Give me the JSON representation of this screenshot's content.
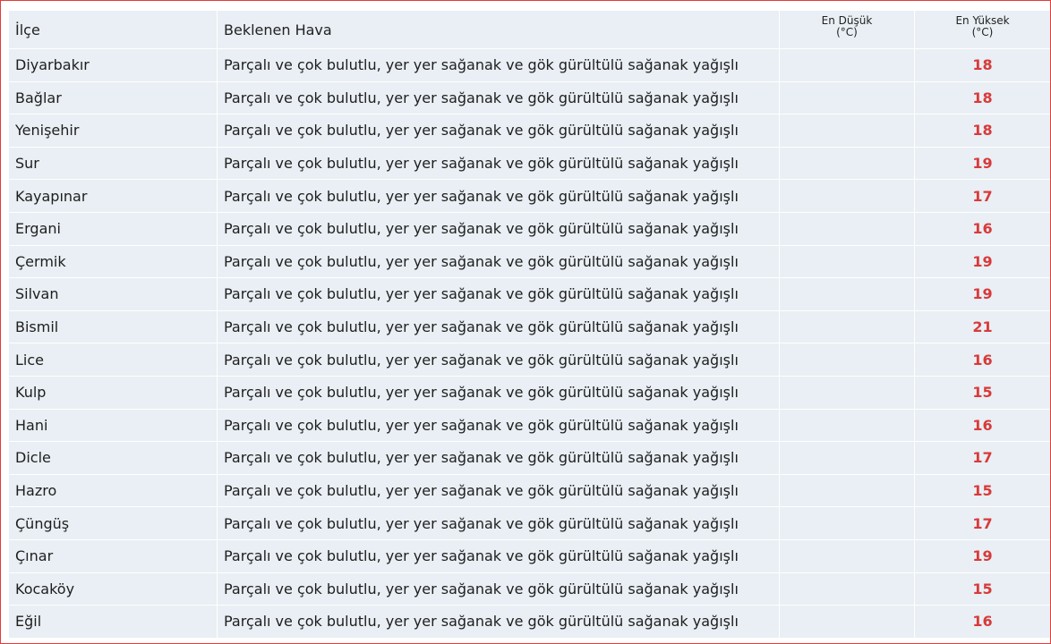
{
  "table": {
    "headers": {
      "district": "İlçe",
      "weather": "Beklenen Hava",
      "min_label": "En Düşük",
      "min_unit": "(°C)",
      "max_label": "En Yüksek",
      "max_unit": "(°C)"
    },
    "rows": [
      {
        "district": "Diyarbakır",
        "weather": "Parçalı ve çok bulutlu, yer yer sağanak ve gök gürültülü sağanak yağışlı",
        "min": "",
        "max": "18"
      },
      {
        "district": "Bağlar",
        "weather": "Parçalı ve çok bulutlu, yer yer sağanak ve gök gürültülü sağanak yağışlı",
        "min": "",
        "max": "18"
      },
      {
        "district": "Yenişehir",
        "weather": "Parçalı ve çok bulutlu, yer yer sağanak ve gök gürültülü sağanak yağışlı",
        "min": "",
        "max": "18"
      },
      {
        "district": "Sur",
        "weather": "Parçalı ve çok bulutlu, yer yer sağanak ve gök gürültülü sağanak yağışlı",
        "min": "",
        "max": "19"
      },
      {
        "district": "Kayapınar",
        "weather": "Parçalı ve çok bulutlu, yer yer sağanak ve gök gürültülü sağanak yağışlı",
        "min": "",
        "max": "17"
      },
      {
        "district": "Ergani",
        "weather": "Parçalı ve çok bulutlu, yer yer sağanak ve gök gürültülü sağanak yağışlı",
        "min": "",
        "max": "16"
      },
      {
        "district": "Çermik",
        "weather": "Parçalı ve çok bulutlu, yer yer sağanak ve gök gürültülü sağanak yağışlı",
        "min": "",
        "max": "19"
      },
      {
        "district": "Silvan",
        "weather": "Parçalı ve çok bulutlu, yer yer sağanak ve gök gürültülü sağanak yağışlı",
        "min": "",
        "max": "19"
      },
      {
        "district": "Bismil",
        "weather": "Parçalı ve çok bulutlu, yer yer sağanak ve gök gürültülü sağanak yağışlı",
        "min": "",
        "max": "21"
      },
      {
        "district": "Lice",
        "weather": "Parçalı ve çok bulutlu, yer yer sağanak ve gök gürültülü sağanak yağışlı",
        "min": "",
        "max": "16"
      },
      {
        "district": "Kulp",
        "weather": "Parçalı ve çok bulutlu, yer yer sağanak ve gök gürültülü sağanak yağışlı",
        "min": "",
        "max": "15"
      },
      {
        "district": "Hani",
        "weather": "Parçalı ve çok bulutlu, yer yer sağanak ve gök gürültülü sağanak yağışlı",
        "min": "",
        "max": "16"
      },
      {
        "district": "Dicle",
        "weather": "Parçalı ve çok bulutlu, yer yer sağanak ve gök gürültülü sağanak yağışlı",
        "min": "",
        "max": "17"
      },
      {
        "district": "Hazro",
        "weather": "Parçalı ve çok bulutlu, yer yer sağanak ve gök gürültülü sağanak yağışlı",
        "min": "",
        "max": "15"
      },
      {
        "district": "Çüngüş",
        "weather": "Parçalı ve çok bulutlu, yer yer sağanak ve gök gürültülü sağanak yağışlı",
        "min": "",
        "max": "17"
      },
      {
        "district": "Çınar",
        "weather": "Parçalı ve çok bulutlu, yer yer sağanak ve gök gürültülü sağanak yağışlı",
        "min": "",
        "max": "19"
      },
      {
        "district": "Kocaköy",
        "weather": "Parçalı ve çok bulutlu, yer yer sağanak ve gök gürültülü sağanak yağışlı",
        "min": "",
        "max": "15"
      },
      {
        "district": "Eğil",
        "weather": "Parçalı ve çok bulutlu, yer yer sağanak ve gök gürültülü sağanak yağışlı",
        "min": "",
        "max": "16"
      }
    ]
  },
  "colors": {
    "cell_background": "#e9eff4",
    "max_temperature": "#d83a3a",
    "frame_border": "#e23b3b"
  }
}
